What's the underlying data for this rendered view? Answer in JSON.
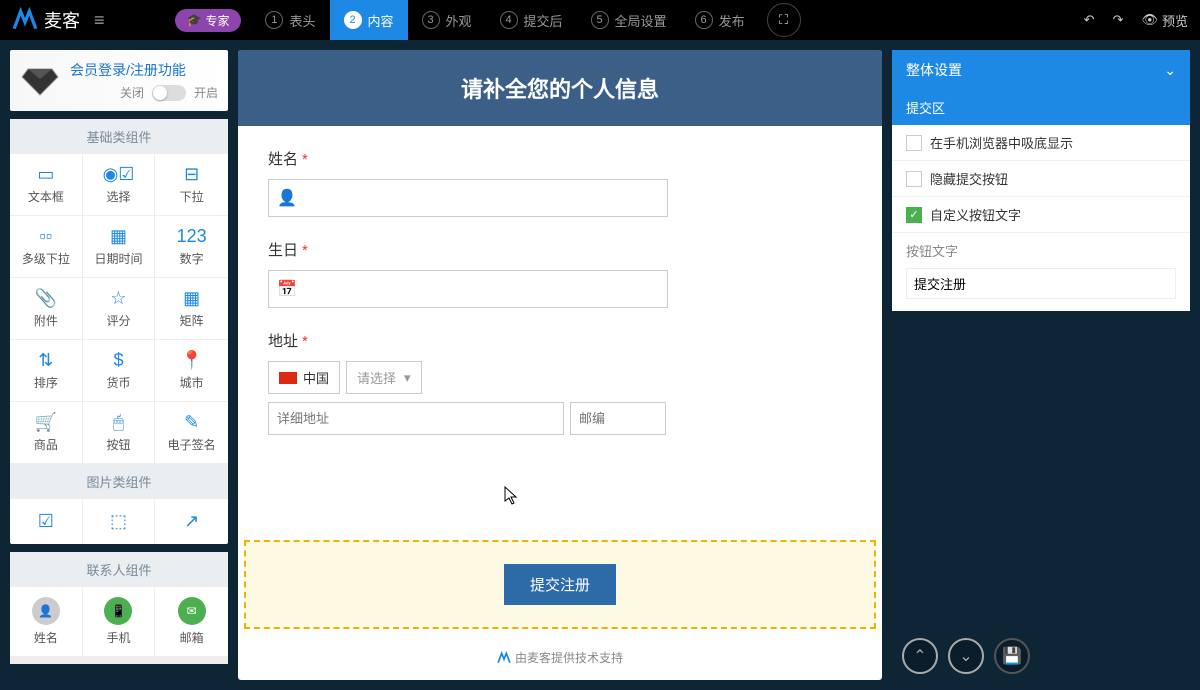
{
  "brand": "麦客",
  "expert_badge": "专家",
  "steps": [
    {
      "num": "1",
      "label": "表头"
    },
    {
      "num": "2",
      "label": "内容",
      "active": true
    },
    {
      "num": "3",
      "label": "外观"
    },
    {
      "num": "4",
      "label": "提交后"
    },
    {
      "num": "5",
      "label": "全局设置"
    },
    {
      "num": "6",
      "label": "发布"
    }
  ],
  "top_right": {
    "preview": "预览"
  },
  "login_panel": {
    "title": "会员登录/注册功能",
    "off": "关闭",
    "on": "开启"
  },
  "sections": {
    "basic": "基础类组件",
    "image": "图片类组件",
    "contact": "联系人组件"
  },
  "basic_components": [
    {
      "icon": "▭",
      "label": "文本框"
    },
    {
      "icon": "◉☑",
      "label": "选择"
    },
    {
      "icon": "⊟",
      "label": "下拉"
    },
    {
      "icon": "▫▫",
      "label": "多级下拉"
    },
    {
      "icon": "▦",
      "label": "日期时间"
    },
    {
      "icon": "123",
      "label": "数字"
    },
    {
      "icon": "📎",
      "label": "附件"
    },
    {
      "icon": "☆",
      "label": "评分"
    },
    {
      "icon": "▦",
      "label": "矩阵"
    },
    {
      "icon": "⇅",
      "label": "排序"
    },
    {
      "icon": "$",
      "label": "货币"
    },
    {
      "icon": "📍",
      "label": "城市"
    },
    {
      "icon": "🛒",
      "label": "商品"
    },
    {
      "icon": "🖱",
      "label": "按钮"
    },
    {
      "icon": "✎",
      "label": "电子签名"
    }
  ],
  "contact_components": [
    {
      "label": "姓名",
      "bg": "#ccc",
      "icon": "👤"
    },
    {
      "label": "手机",
      "bg": "#4caf50",
      "icon": "📱"
    },
    {
      "label": "邮箱",
      "bg": "#4caf50",
      "icon": "✉"
    }
  ],
  "form": {
    "title": "请补全您的个人信息",
    "fields": {
      "name": {
        "label": "姓名"
      },
      "birthday": {
        "label": "生日"
      },
      "address": {
        "label": "地址",
        "country": "中国",
        "region_placeholder": "请选择",
        "detail_placeholder": "详细地址",
        "zip_placeholder": "邮编"
      }
    },
    "submit": "提交注册",
    "credit": "由麦客提供技术支持"
  },
  "right_panel": {
    "overall": "整体设置",
    "submit_section": "提交区",
    "checks": [
      {
        "label": "在手机浏览器中吸底显示",
        "checked": false
      },
      {
        "label": "隐藏提交按钮",
        "checked": false
      },
      {
        "label": "自定义按钮文字",
        "checked": true
      }
    ],
    "button_text_label": "按钮文字",
    "button_text_value": "提交注册"
  }
}
